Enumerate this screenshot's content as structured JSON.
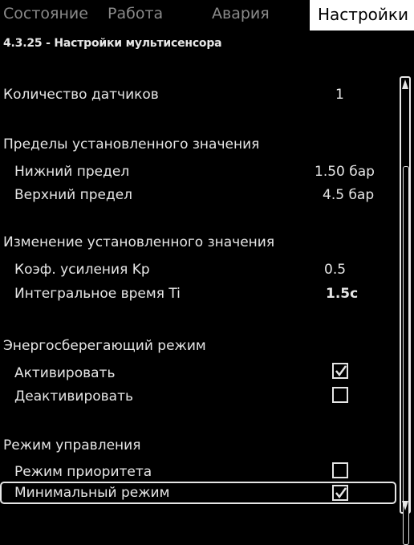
{
  "tabs": {
    "status": "Состояние",
    "operation": "Работа",
    "alarm": "Авария",
    "settings": "Настройки"
  },
  "subtitle": "4.3.25 - Настройки мультисенсора",
  "settings": {
    "sensor_count_label": "Количество датчиков",
    "sensor_count_value": "1",
    "setpoint_limits_header": "Пределы установленного значения",
    "lower_limit_label": "Нижний предел",
    "lower_limit_value": "1.50 бар",
    "upper_limit_label": "Верхний предел",
    "upper_limit_value": "4.5 бар",
    "setpoint_change_header": "Изменение установленного значения",
    "kp_label": "Коэф. усиления Kp",
    "kp_value": "0.5",
    "ti_label": "Интегральное время Ti",
    "ti_value": "1.5с",
    "energy_saving_header": "Энергосберегающий режим",
    "activate_label": "Активировать",
    "activate_checked": true,
    "deactivate_label": "Деактивировать",
    "deactivate_checked": false,
    "control_mode_header": "Режим управления",
    "priority_mode_label": "Режим приоритета",
    "priority_mode_checked": false,
    "minimal_mode_label": "Минимальный режим",
    "minimal_mode_checked": true
  },
  "colors": {
    "background": "#000000",
    "text": "#e6e6e6",
    "active_tab_bg": "#ffffff",
    "inactive_tab_text": "#8a8a8a"
  }
}
